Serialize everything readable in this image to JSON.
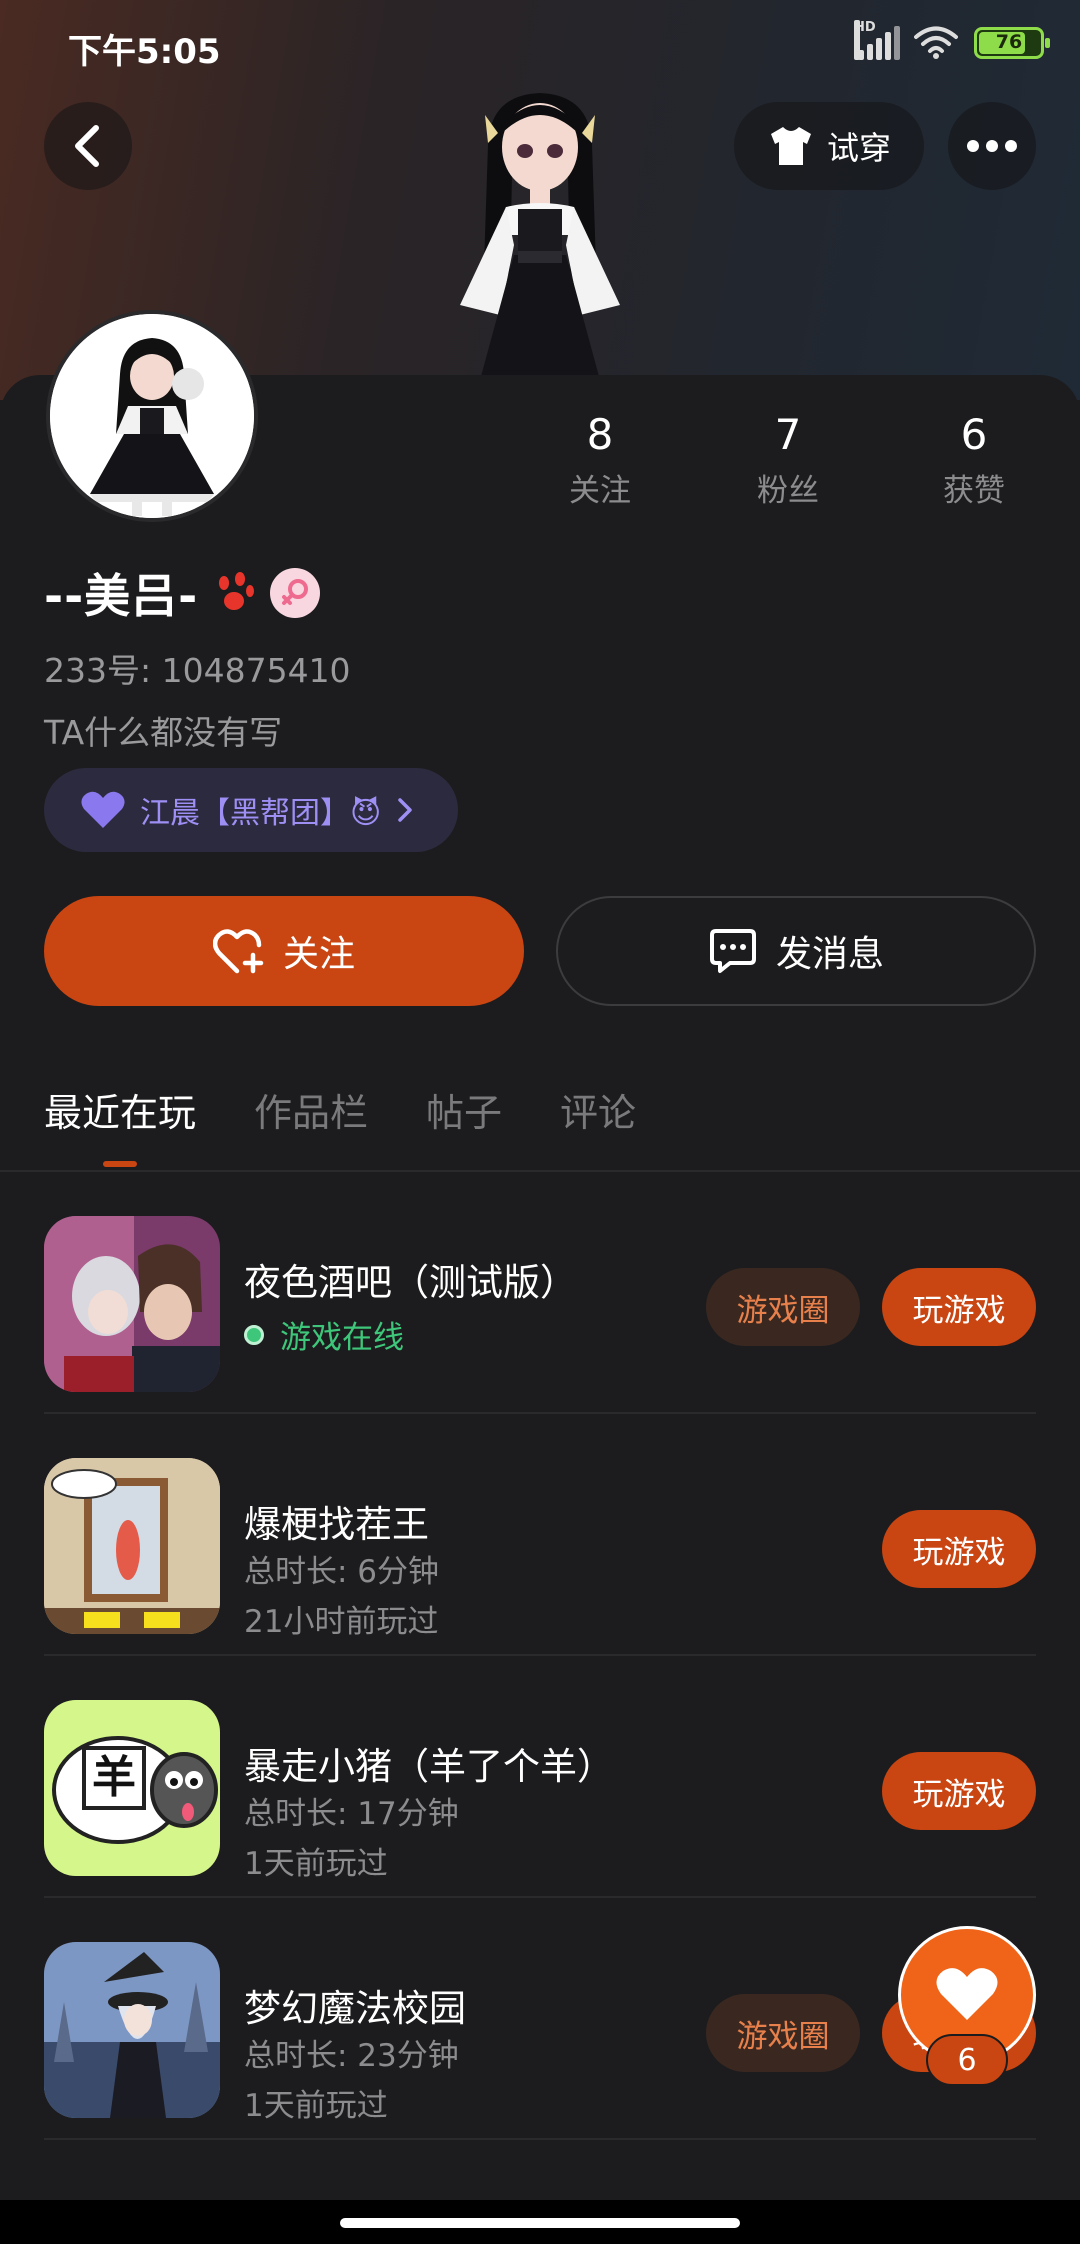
{
  "status_bar": {
    "time": "下午5:05",
    "signal_badge": "HD",
    "battery": "76"
  },
  "header": {
    "try_on_label": "试穿"
  },
  "stats": [
    {
      "value": "8",
      "label": "关注"
    },
    {
      "value": "7",
      "label": "粉丝"
    },
    {
      "value": "6",
      "label": "获赞"
    }
  ],
  "profile": {
    "name": "--美吕-",
    "uid": "233号: 104875410",
    "bio": "TA什么都没有写",
    "cp_label": "江晨【黑帮团】😈"
  },
  "actions": {
    "follow_label": "关注",
    "message_label": "发消息"
  },
  "tabs": [
    {
      "label": "最近在玩"
    },
    {
      "label": "作品栏"
    },
    {
      "label": "帖子"
    },
    {
      "label": "评论"
    }
  ],
  "games": [
    {
      "name": "夜色酒吧（测试版）",
      "status": "游戏在线",
      "community_label": "游戏圈",
      "play_label": "玩游戏"
    },
    {
      "name": "爆梗找茬王",
      "duration": "总时长: 6分钟",
      "last_played": "21小时前玩过",
      "play_label": "玩游戏"
    },
    {
      "name": "暴走小猪（羊了个羊）",
      "duration": "总时长: 17分钟",
      "last_played": "1天前玩过",
      "play_label": "玩游戏",
      "icon_text": "羊"
    },
    {
      "name": "梦幻魔法校园",
      "duration": "总时长: 23分钟",
      "last_played": "1天前玩过",
      "community_label": "游戏圈",
      "play_label": "玩游戏"
    }
  ],
  "float_like": {
    "count": "6"
  },
  "colors": {
    "accent": "#c94512",
    "online": "#3ec77a",
    "cp": "#9d8ff3",
    "background": "#1c1c1e"
  }
}
